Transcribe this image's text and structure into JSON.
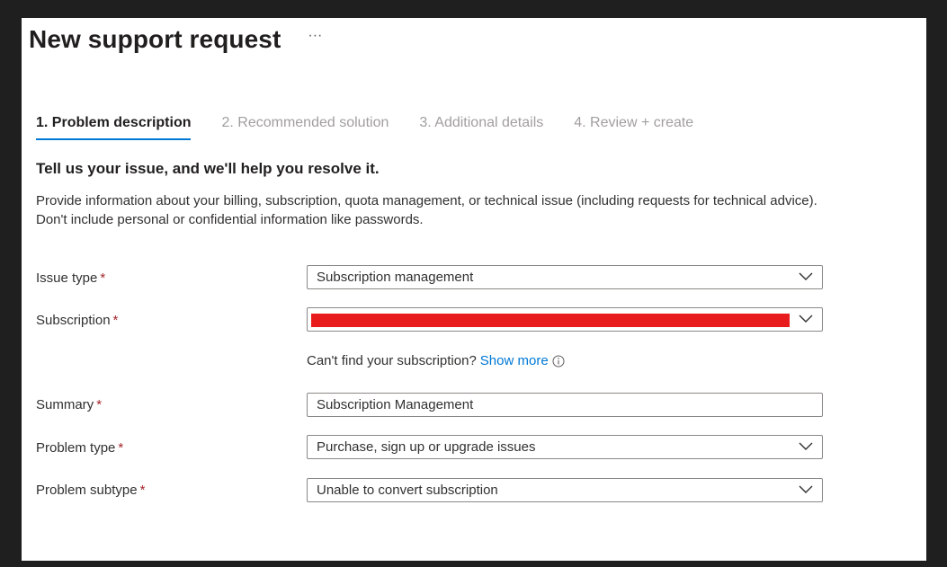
{
  "page": {
    "title": "New support request",
    "more": "···"
  },
  "tabs": [
    {
      "label": "1. Problem description"
    },
    {
      "label": "2. Recommended solution"
    },
    {
      "label": "3. Additional details"
    },
    {
      "label": "4. Review + create"
    }
  ],
  "heading": "Tell us your issue, and we'll help you resolve it.",
  "description": "Provide information about your billing, subscription, quota management, or technical issue (including requests for technical advice). Don't include personal or confidential information like passwords.",
  "required_marker": "*",
  "form": {
    "issue_type": {
      "label": "Issue type",
      "value": "Subscription management"
    },
    "subscription": {
      "label": "Subscription",
      "redaction_color": "#e81c1c"
    },
    "helper": {
      "text": "Can't find your subscription?",
      "link": "Show more"
    },
    "summary": {
      "label": "Summary",
      "value": "Subscription Management"
    },
    "problem_type": {
      "label": "Problem type",
      "value": "Purchase, sign up or upgrade issues"
    },
    "problem_subtype": {
      "label": "Problem subtype",
      "value": "Unable to convert subscription"
    }
  },
  "colors": {
    "accent": "#0078d4",
    "required": "#a4262c",
    "link": "#0078d4"
  }
}
